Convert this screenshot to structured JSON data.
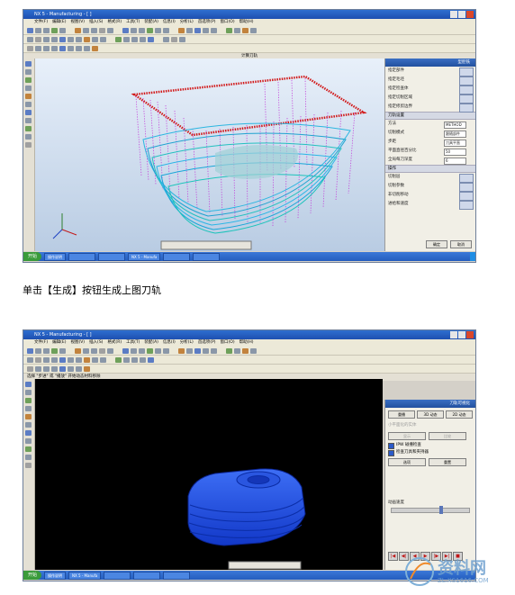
{
  "screenshot1": {
    "window_title": "NX 5 - Manufacturing - [ ]",
    "menu": [
      "文件(F)",
      "编辑(E)",
      "视图(V)",
      "插入(S)",
      "格式(R)",
      "工具(T)",
      "装配(A)",
      "信息(I)",
      "分析(L)",
      "首选项(P)",
      "窗口(O)",
      "帮助(H)"
    ],
    "viewport_label": "计算刀轨",
    "panel_title": "型腔铣",
    "panel_rows": [
      "指定部件",
      "指定毛坯",
      "指定检查体",
      "指定切削区域",
      "指定修剪边界"
    ],
    "panel_section": "刀轨设置",
    "fields": [
      {
        "label": "方法",
        "value": "METHOD"
      },
      {
        "label": "切削模式",
        "value": "跟随部件"
      },
      {
        "label": "步距",
        "value": "刀具平直"
      },
      {
        "label": "平面直径百分比",
        "value": "50"
      },
      {
        "label": "全局每刀深度",
        "value": "6"
      }
    ],
    "actions_section": "操作",
    "actions": [
      "切削层",
      "切削参数",
      "非切削移动",
      "进给和速度"
    ],
    "ok": "确定",
    "cancel": "取消",
    "start": "开始",
    "taskbar_items": [
      "操作说明",
      "",
      "",
      "NX 5 - Manufa",
      "",
      "",
      ""
    ],
    "tray_time": ""
  },
  "caption": "单击【生成】按钮生成上图刀轨",
  "screenshot2": {
    "window_title": "NX 5 - Manufacturing - [    ]",
    "menu": [
      "文件(F)",
      "编辑(E)",
      "视图(V)",
      "插入(S)",
      "格式(R)",
      "工具(T)",
      "装配(A)",
      "信息(I)",
      "分析(L)",
      "首选项(P)",
      "窗口(O)",
      "帮助(H)"
    ],
    "prompt": "选择 \"步进\" 或 \"播放\" 开始动态材料移除",
    "panel_title": "刀轨可视化",
    "tabs": [
      "重播",
      "3D 动态",
      "2D 动态"
    ],
    "check_options": [
      "IPW 碰撞检查",
      "检查刀具和夹持器"
    ],
    "buttons": [
      "显示",
      "比较",
      "选项",
      "重置"
    ],
    "section_label": "小平面化的实体",
    "speed_label": "动画速度",
    "start": "开始",
    "taskbar_items": [
      "操作说明",
      "NX 5 - Manufa",
      "",
      "",
      ""
    ]
  },
  "watermark": {
    "text": "资料网",
    "url": "ZL.XS1616.COM"
  }
}
